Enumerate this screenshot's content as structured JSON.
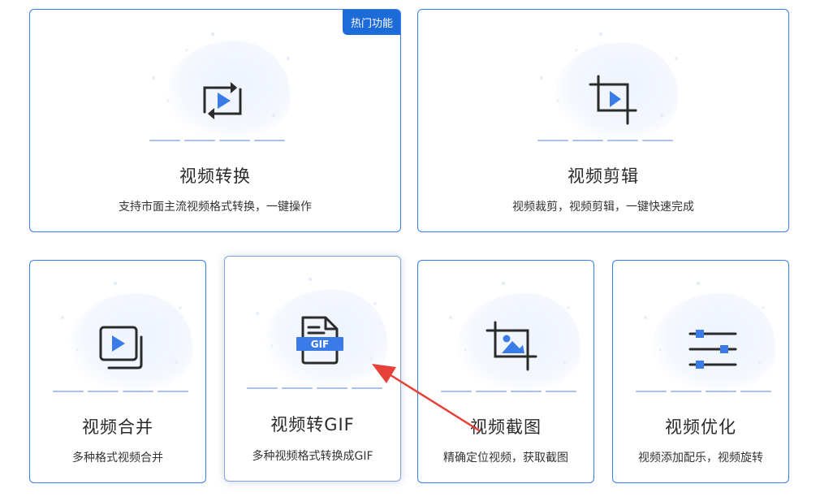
{
  "cards": {
    "video_convert": {
      "title": "视频转换",
      "desc": "支持市面主流视频格式转换，一键操作",
      "badge": "热门功能",
      "icon": "convert-icon"
    },
    "video_edit": {
      "title": "视频剪辑",
      "desc": "视频裁剪，视频剪辑，一键快速完成",
      "icon": "crop-play-icon"
    },
    "video_merge": {
      "title": "视频合并",
      "desc": "多种格式视频合并",
      "icon": "merge-icon"
    },
    "video_to_gif": {
      "title": "视频转GIF",
      "desc": "多种视频格式转换成GIF",
      "icon_label": "GIF",
      "icon": "gif-file-icon"
    },
    "video_screenshot": {
      "title": "视频截图",
      "desc": "精确定位视频，获取截图",
      "icon": "crop-image-icon"
    },
    "video_optimize": {
      "title": "视频优化",
      "desc": "视频添加配乐，视频旋转",
      "icon": "sliders-icon"
    }
  },
  "colors": {
    "accent": "#3d7de8",
    "badge": "#1d6ad9",
    "icon_blue": "#3a7be8",
    "icon_dark": "#2b2b2b",
    "annotation_arrow": "#e8413a"
  }
}
